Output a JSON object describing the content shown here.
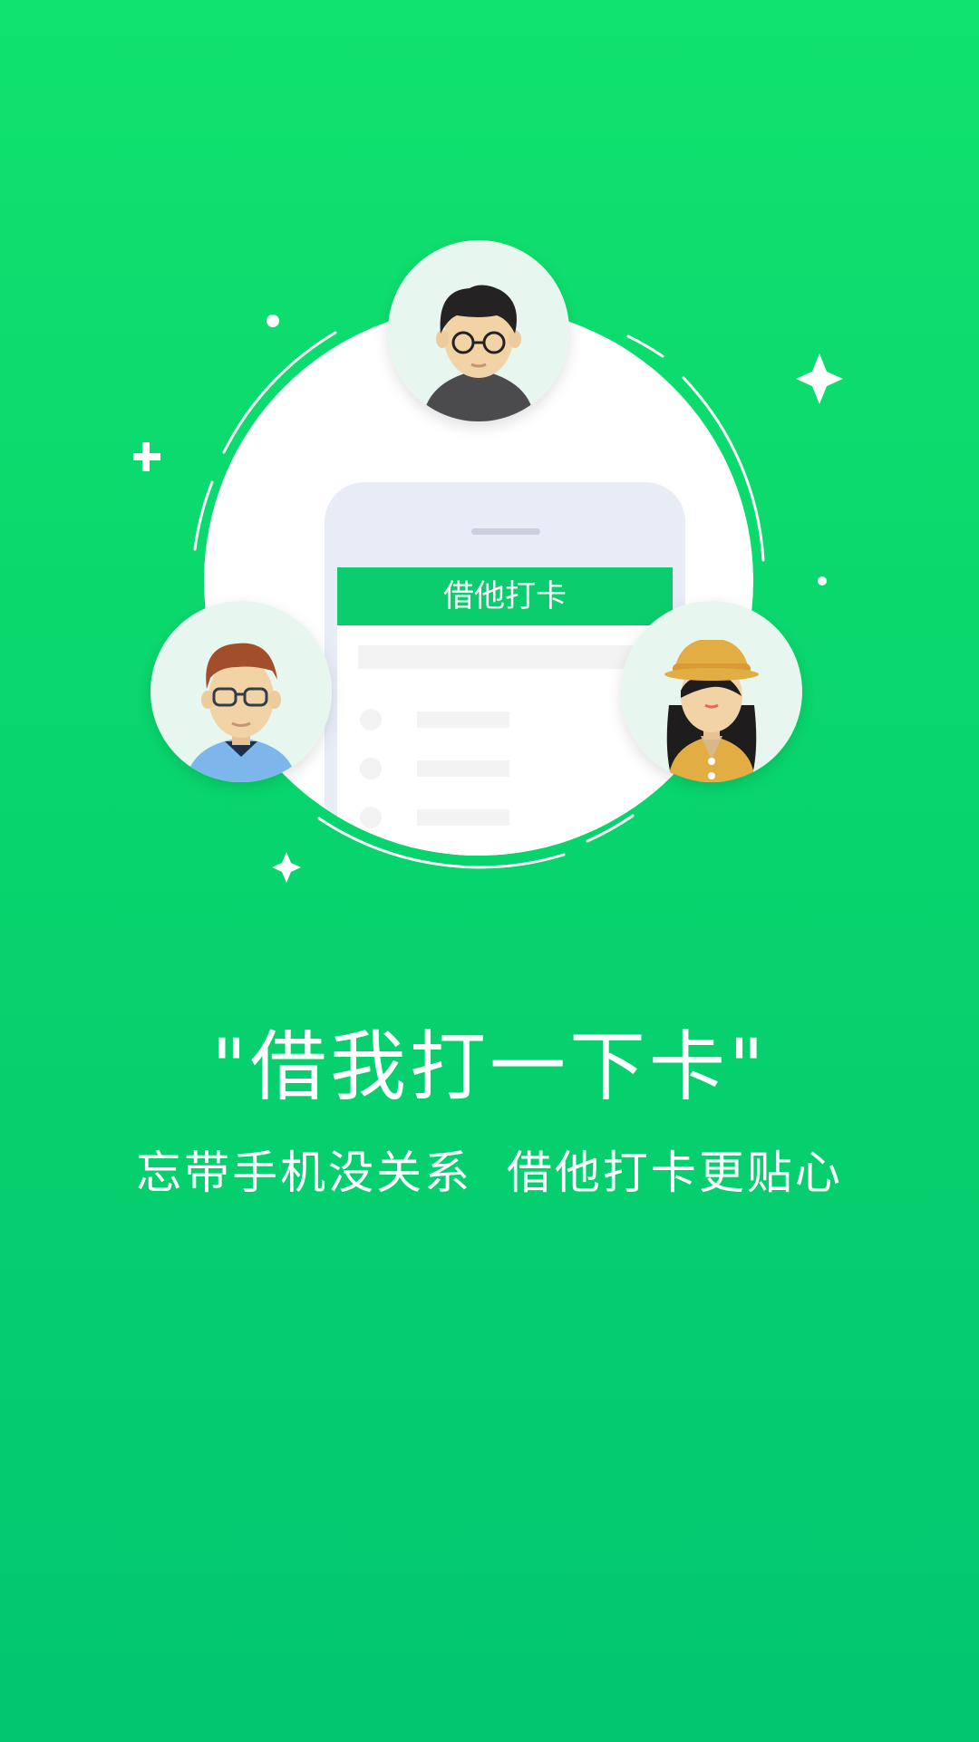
{
  "screen": "onboarding-borrow-punch",
  "illustration": {
    "phone_header_title": "借他打卡",
    "avatars": [
      "man-dark-hair-glasses-avatar",
      "man-brown-hair-glasses-avatar",
      "woman-yellow-hat-avatar"
    ]
  },
  "headline": "\"借我打一下卡\"",
  "subtitle": "忘带手机没关系  借他打卡更贴心",
  "colors": {
    "background_top": "#10e26e",
    "background_bottom": "#02c670",
    "accent_green": "#0bcd6d",
    "text": "#ffffff"
  }
}
